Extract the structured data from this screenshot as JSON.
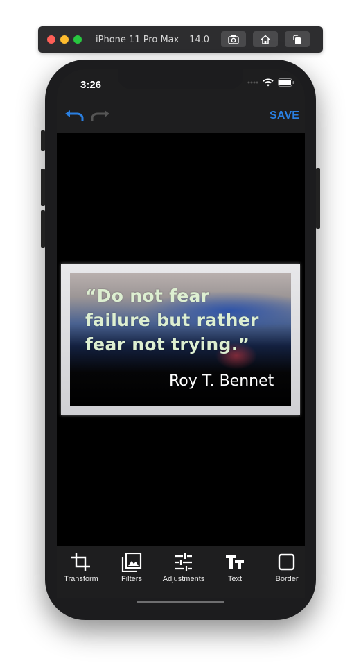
{
  "simulator": {
    "title": "iPhone 11 Pro Max – 14.0",
    "buttons": [
      "screenshot-icon",
      "home-icon",
      "rotate-icon"
    ]
  },
  "status_bar": {
    "time": "3:26"
  },
  "nav": {
    "undo_icon": "undo-icon",
    "redo_icon": "redo-icon",
    "save_label": "SAVE",
    "accent_color": "#2a7fe0"
  },
  "image": {
    "quote_lines": [
      "“Do not fear",
      "failure but rather",
      "fear not trying.”"
    ],
    "author": "Roy T. Bennet"
  },
  "toolbar": {
    "items": [
      {
        "label": "Transform",
        "icon": "crop-icon"
      },
      {
        "label": "Filters",
        "icon": "filters-icon"
      },
      {
        "label": "Adjustments",
        "icon": "sliders-icon"
      },
      {
        "label": "Text",
        "icon": "text-icon"
      },
      {
        "label": "Border",
        "icon": "border-icon"
      }
    ]
  }
}
